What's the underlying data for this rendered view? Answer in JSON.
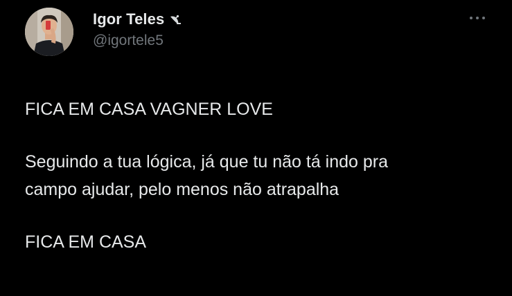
{
  "user": {
    "display_name": "Igor Teles",
    "handle": "@igortele5",
    "emoji_icon": "satellite-dish-icon",
    "avatar_icon": "profile-photo"
  },
  "menu": {
    "icon": "more-options-icon"
  },
  "tweet": {
    "line1": "FICA EM CASA VAGNER LOVE",
    "line2a": "Seguindo a tua lógica, já que tu não tá indo pra",
    "line2b": "campo ajudar, pelo menos não atrapalha",
    "line3": "FICA EM CASA"
  },
  "colors": {
    "background": "#000000",
    "text_primary": "#e7e9ea",
    "text_secondary": "#71767b"
  }
}
